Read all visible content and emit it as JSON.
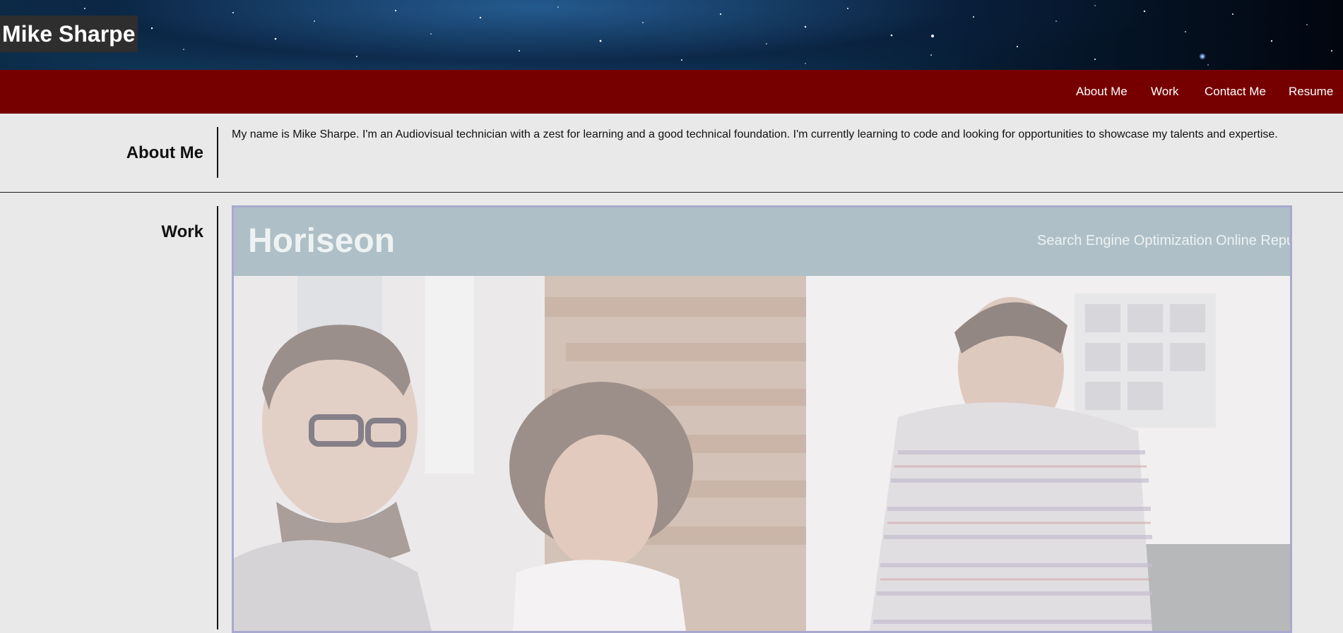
{
  "header": {
    "site_title": "Mike Sharpe"
  },
  "nav": {
    "items": [
      {
        "label": "About Me"
      },
      {
        "label": "Work"
      },
      {
        "label": "Contact Me"
      },
      {
        "label": "Resume"
      }
    ]
  },
  "about": {
    "heading": "About Me",
    "text": "My name is Mike Sharpe. I'm an Audiovisual technician with a zest for learning and a good technical foundation. I'm currently learning to code and looking for opportunities to showcase my talents and expertise."
  },
  "work": {
    "heading": "Work",
    "projects": [
      {
        "brand": "Horiseon",
        "nav": [
          "Search Engine Optimization",
          "Online Repu"
        ]
      }
    ]
  },
  "colors": {
    "nav_background": "#760000",
    "page_background": "#e9e9e9",
    "card_border": "#a9a8cf",
    "project_header": "#aebfc7"
  }
}
